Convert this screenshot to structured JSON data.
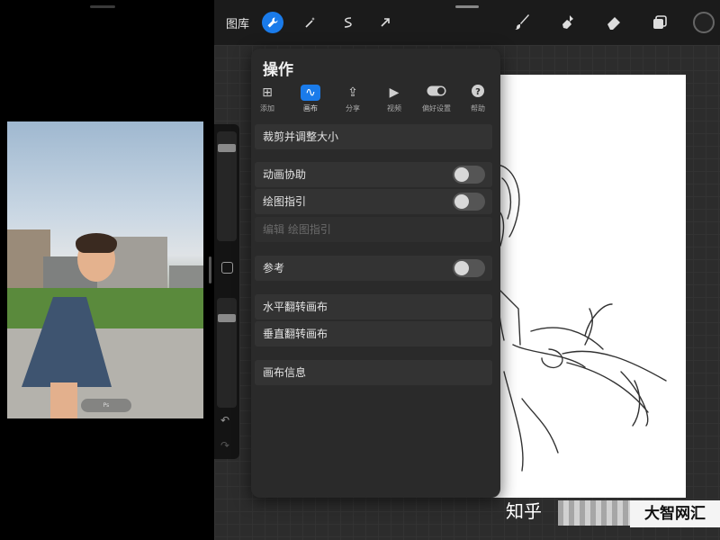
{
  "left_pane": {
    "photo_caption": "Ps"
  },
  "topbar": {
    "gallery_label": "图库",
    "tools": [
      {
        "name": "wrench-icon",
        "active": true
      },
      {
        "name": "magic-wand-icon",
        "active": false
      },
      {
        "name": "selection-icon",
        "active": false
      },
      {
        "name": "transform-arrow-icon",
        "active": false
      }
    ],
    "right_tools": [
      "brush-icon",
      "smudge-icon",
      "eraser-icon",
      "layers-icon"
    ],
    "current_color": "#222222"
  },
  "actions": {
    "title": "操作",
    "tabs": [
      {
        "label": "添加",
        "icon": "add-icon"
      },
      {
        "label": "画布",
        "icon": "canvas-icon",
        "active": true
      },
      {
        "label": "分享",
        "icon": "share-icon"
      },
      {
        "label": "视频",
        "icon": "video-icon"
      },
      {
        "label": "偏好设置",
        "icon": "prefs-toggle-icon"
      },
      {
        "label": "帮助",
        "icon": "help-icon"
      }
    ],
    "rows": {
      "crop_resize": "裁剪并调整大小",
      "animation_assist": "动画协助",
      "animation_assist_on": false,
      "drawing_guide": "绘图指引",
      "drawing_guide_on": false,
      "edit_drawing_guide": "编辑 绘图指引",
      "reference": "参考",
      "reference_on": false,
      "flip_horizontal": "水平翻转画布",
      "flip_vertical": "垂直翻转画布",
      "canvas_info": "画布信息"
    }
  },
  "watermarks": {
    "zhihu": "知乎",
    "site": "大智网汇"
  },
  "colors": {
    "accent": "#1a7bea",
    "panel": "#2a2a2a",
    "row": "#333333"
  }
}
